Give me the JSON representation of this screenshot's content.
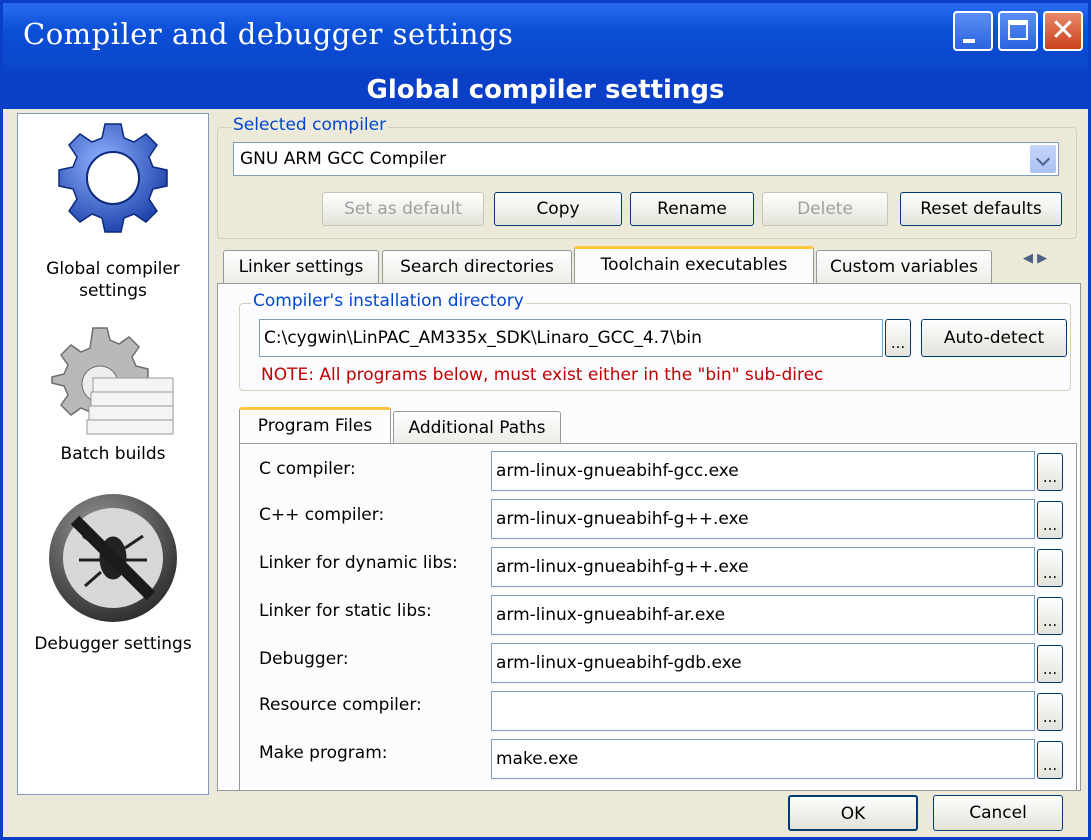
{
  "window": {
    "title": "Compiler and debugger settings",
    "banner": "Global compiler settings"
  },
  "sidebar": {
    "items": [
      {
        "label": "Global compiler\nsettings",
        "icon": "gear-icon"
      },
      {
        "label": "Batch builds",
        "icon": "batch-gear-icon"
      },
      {
        "label": "Debugger settings",
        "icon": "no-bug-icon"
      }
    ]
  },
  "selected_compiler": {
    "legend": "Selected compiler",
    "value": "GNU ARM GCC Compiler",
    "buttons": {
      "set_default": "Set as default",
      "copy": "Copy",
      "rename": "Rename",
      "delete": "Delete",
      "reset": "Reset defaults"
    }
  },
  "tabs": [
    {
      "label": "Linker settings"
    },
    {
      "label": "Search directories"
    },
    {
      "label": "Toolchain executables",
      "active": true
    },
    {
      "label": "Custom variables"
    }
  ],
  "install_dir": {
    "legend": "Compiler's installation directory",
    "value": "C:\\cygwin\\LinPAC_AM335x_SDK\\Linaro_GCC_4.7\\bin",
    "browse": "...",
    "autodetect": "Auto-detect",
    "note": "NOTE: All programs below, must exist either in the \"bin\" sub-direc"
  },
  "subtabs": [
    {
      "label": "Program Files",
      "active": true
    },
    {
      "label": "Additional Paths"
    }
  ],
  "programs": [
    {
      "label": "C compiler:",
      "value": "arm-linux-gnueabihf-gcc.exe"
    },
    {
      "label": "C++ compiler:",
      "value": "arm-linux-gnueabihf-g++.exe"
    },
    {
      "label": "Linker for dynamic libs:",
      "value": "arm-linux-gnueabihf-g++.exe"
    },
    {
      "label": "Linker for static libs:",
      "value": "arm-linux-gnueabihf-ar.exe"
    },
    {
      "label": "Debugger:",
      "value": "arm-linux-gnueabihf-gdb.exe"
    },
    {
      "label": "Resource compiler:",
      "value": ""
    },
    {
      "label": "Make program:",
      "value": "make.exe"
    }
  ],
  "browse_label": "...",
  "footer": {
    "ok": "OK",
    "cancel": "Cancel"
  },
  "colors": {
    "title_bar": "#0a45c8",
    "legend_text": "#0046d5",
    "note_text": "#c00000",
    "active_tab_accent": "#ffc83c"
  }
}
